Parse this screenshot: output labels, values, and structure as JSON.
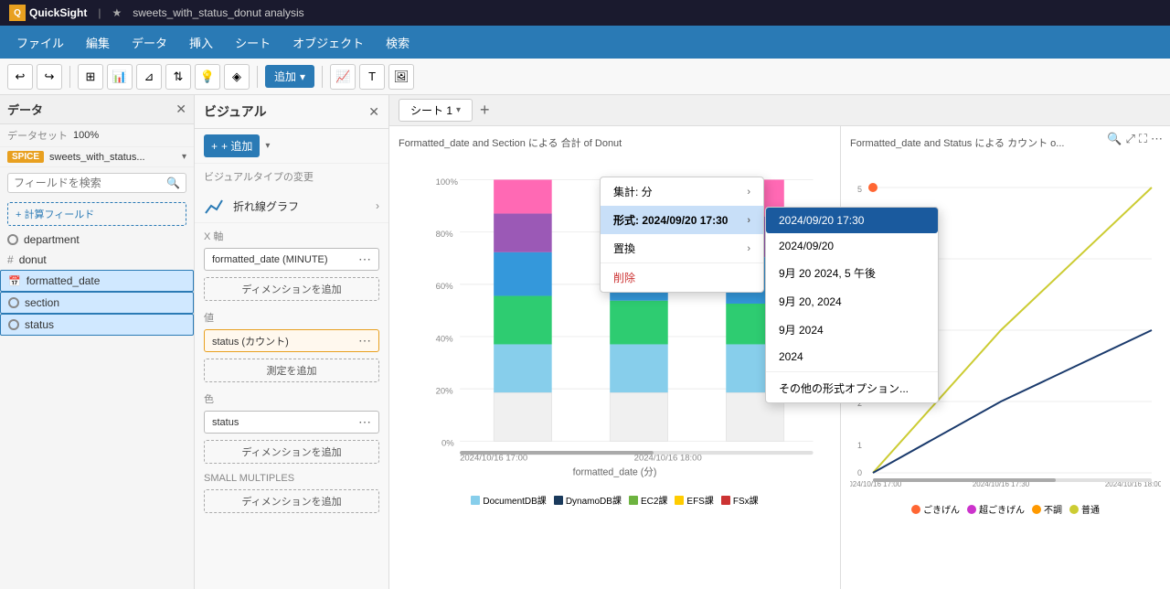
{
  "titleBar": {
    "appName": "QuickSight",
    "tabTitle": "sweets_with_status_donut analysis",
    "starIcon": "★"
  },
  "menuBar": {
    "items": [
      "ファイル",
      "編集",
      "データ",
      "挿入",
      "シート",
      "オブジェクト",
      "検索"
    ]
  },
  "toolbar": {
    "addLabel": "追加",
    "buttons": [
      "undo",
      "redo",
      "table",
      "chart",
      "filter",
      "sort",
      "bulb",
      "visual",
      "add"
    ]
  },
  "leftPanel": {
    "title": "データ",
    "datasetLabel": "データセット",
    "datasetPct": "100%",
    "spiceBadge": "SPICE",
    "datasetName": "sweets_with_status...",
    "searchPlaceholder": "フィールドを検索",
    "calcFieldLabel": "+ 計算フィールド",
    "fields": [
      {
        "icon": "circle",
        "name": "department"
      },
      {
        "icon": "hash",
        "name": "donut"
      },
      {
        "icon": "cal",
        "name": "formatted_date",
        "active": true
      },
      {
        "icon": "circle",
        "name": "section",
        "active": true
      },
      {
        "icon": "circle",
        "name": "status",
        "active": true
      }
    ]
  },
  "middlePanel": {
    "title": "ビジュアル",
    "closeIcon": "✕",
    "addLabel": "+ 追加",
    "visualTypeLabel": "ビジュアルタイプの変更",
    "visualTypeIcon": "折れ線グラフ",
    "xAxisLabel": "X 軸",
    "xAxisField": "formatted_date (MINUTE)",
    "addDimension1": "ディメンションを追加",
    "valueLabel": "値",
    "valueField": "status (カウント)",
    "addMeasure": "測定を追加",
    "colorLabel": "色",
    "colorField": "status",
    "addDimension2": "ディメンションを追加",
    "smallMultiplesLabel": "SMALL MULTIPLES",
    "addDimension3": "ディメンションを追加"
  },
  "sheetTabs": {
    "tab1": "シート 1",
    "addIcon": "+"
  },
  "leftChart": {
    "title": "Formatted_date and Section による 合計 of Donut",
    "xAxisLabel": "formatted_date (分)",
    "xTick1": "2024/10/16 17:00",
    "xTick2": "2024/10/16 18:00",
    "yLabels": [
      "0%",
      "20%",
      "40%",
      "60%",
      "80%",
      "100%"
    ],
    "legend": [
      {
        "color": "#87ceeb",
        "label": "DocumentDB課"
      },
      {
        "color": "#1a3a5c",
        "label": "DynamoDB課"
      },
      {
        "color": "#6db33f",
        "label": "EC2課"
      },
      {
        "color": "#ffcc00",
        "label": "EFS課"
      },
      {
        "color": "#cc3333",
        "label": "FSx課"
      }
    ]
  },
  "rightChart": {
    "title": "Formatted_date and Status による カウント o...",
    "xTick1": "2024/10/16 17:00",
    "xTick2": "2024/10/16 17:30",
    "xTick3": "2024/10/16 18:00",
    "legend": [
      {
        "color": "#ff6633",
        "label": "ごきげん"
      },
      {
        "color": "#cc33cc",
        "label": "超ごきげん"
      },
      {
        "color": "#ff9900",
        "label": "不調"
      },
      {
        "color": "#cccc33",
        "label": "普通"
      }
    ]
  },
  "contextMenu": {
    "items": [
      {
        "label": "集計: 分",
        "hasArrow": true
      },
      {
        "label": "形式: 2024/09/20 17:30",
        "hasArrow": true,
        "selected": true
      },
      {
        "label": "置換",
        "hasArrow": true
      },
      {
        "label": "削除",
        "isDelete": true
      }
    ]
  },
  "dateSubmenu": {
    "items": [
      {
        "label": "2024/09/20 17:30",
        "selected": true
      },
      {
        "label": "2024/09/20"
      },
      {
        "label": "9月 20 2024, 5 午後"
      },
      {
        "label": "9月 20, 2024"
      },
      {
        "label": "9月 2024"
      },
      {
        "label": "2024"
      },
      {
        "divider": true
      },
      {
        "label": "その他の形式オプション..."
      }
    ]
  }
}
